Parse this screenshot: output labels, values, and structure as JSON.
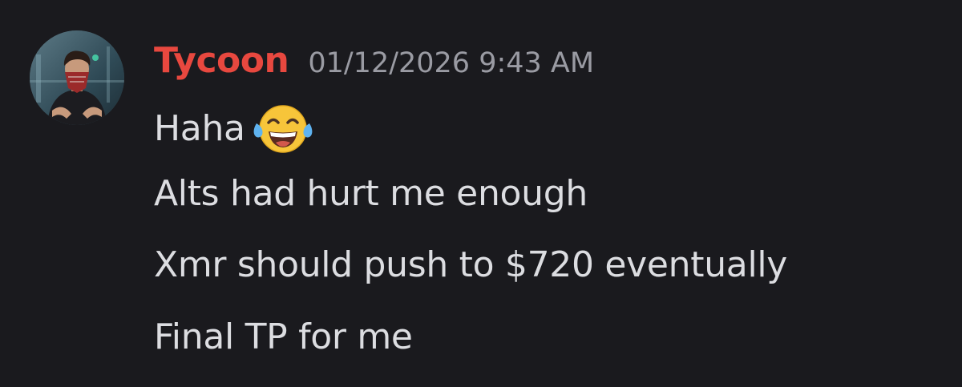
{
  "author": {
    "username": "Tycoon",
    "username_color": "#e8483f",
    "avatar": "user-avatar-photo"
  },
  "timestamp": "01/12/2026 9:43 AM",
  "message_lines": [
    {
      "text": "Haha",
      "emoji": "face-with-tears-of-joy-icon"
    },
    {
      "text": "Alts had hurt me enough"
    },
    {
      "text": "Xmr should push to $720 eventually"
    },
    {
      "text": "Final TP for me"
    }
  ],
  "colors": {
    "background": "#1a1a1e",
    "text": "#dcdde1",
    "timestamp": "#9a9ba3"
  }
}
